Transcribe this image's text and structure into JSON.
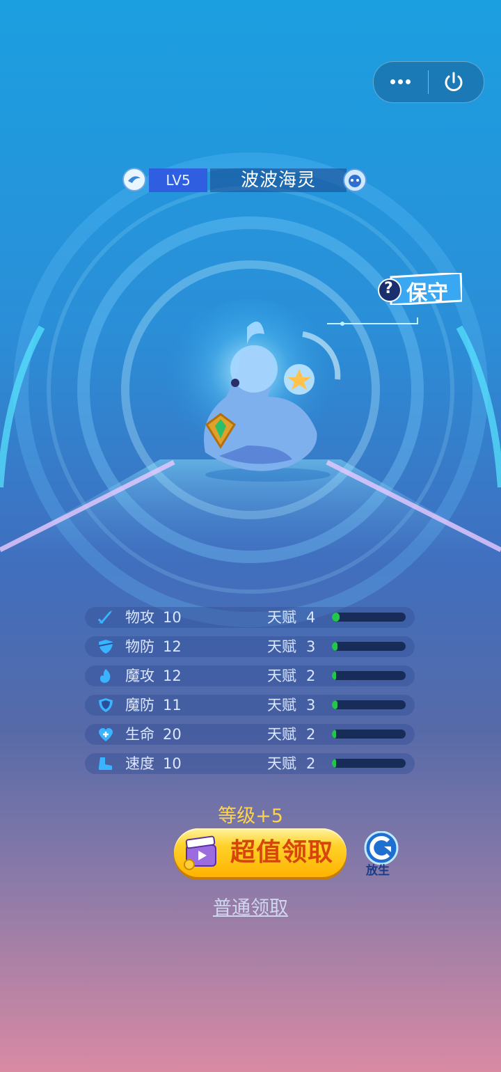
{
  "topbar": {
    "more_icon": "more-dots-icon",
    "close_icon": "power-icon"
  },
  "pet": {
    "level": "LV5",
    "name": "波波海灵",
    "nature": "保守",
    "nature_help": "?"
  },
  "stats": [
    {
      "label": "物攻",
      "value": "10",
      "talent_label": "天赋",
      "talent": "4",
      "talent_level": 0.1,
      "icon": "sword-icon"
    },
    {
      "label": "物防",
      "value": "12",
      "talent_label": "天赋",
      "talent": "3",
      "talent_level": 0.08,
      "icon": "shield-icon"
    },
    {
      "label": "魔攻",
      "value": "12",
      "talent_label": "天赋",
      "talent": "2",
      "talent_level": 0.06,
      "icon": "flame-icon"
    },
    {
      "label": "魔防",
      "value": "11",
      "talent_label": "天赋",
      "talent": "3",
      "talent_level": 0.08,
      "icon": "magic-shield-icon"
    },
    {
      "label": "生命",
      "value": "20",
      "talent_label": "天赋",
      "talent": "2",
      "talent_level": 0.06,
      "icon": "heart-plus-icon"
    },
    {
      "label": "速度",
      "value": "10",
      "talent_label": "天赋",
      "talent": "2",
      "talent_level": 0.06,
      "icon": "boot-icon"
    }
  ],
  "reward": {
    "level_bonus": "等级+5",
    "premium_label": "超值领取",
    "release_label": "放生",
    "normal_label": "普通领取"
  },
  "colors": {
    "accent": "#2f5fe0",
    "button_text": "#d8450a",
    "bonus_text": "#ffd44a",
    "talent_fill": "#21c74a"
  }
}
